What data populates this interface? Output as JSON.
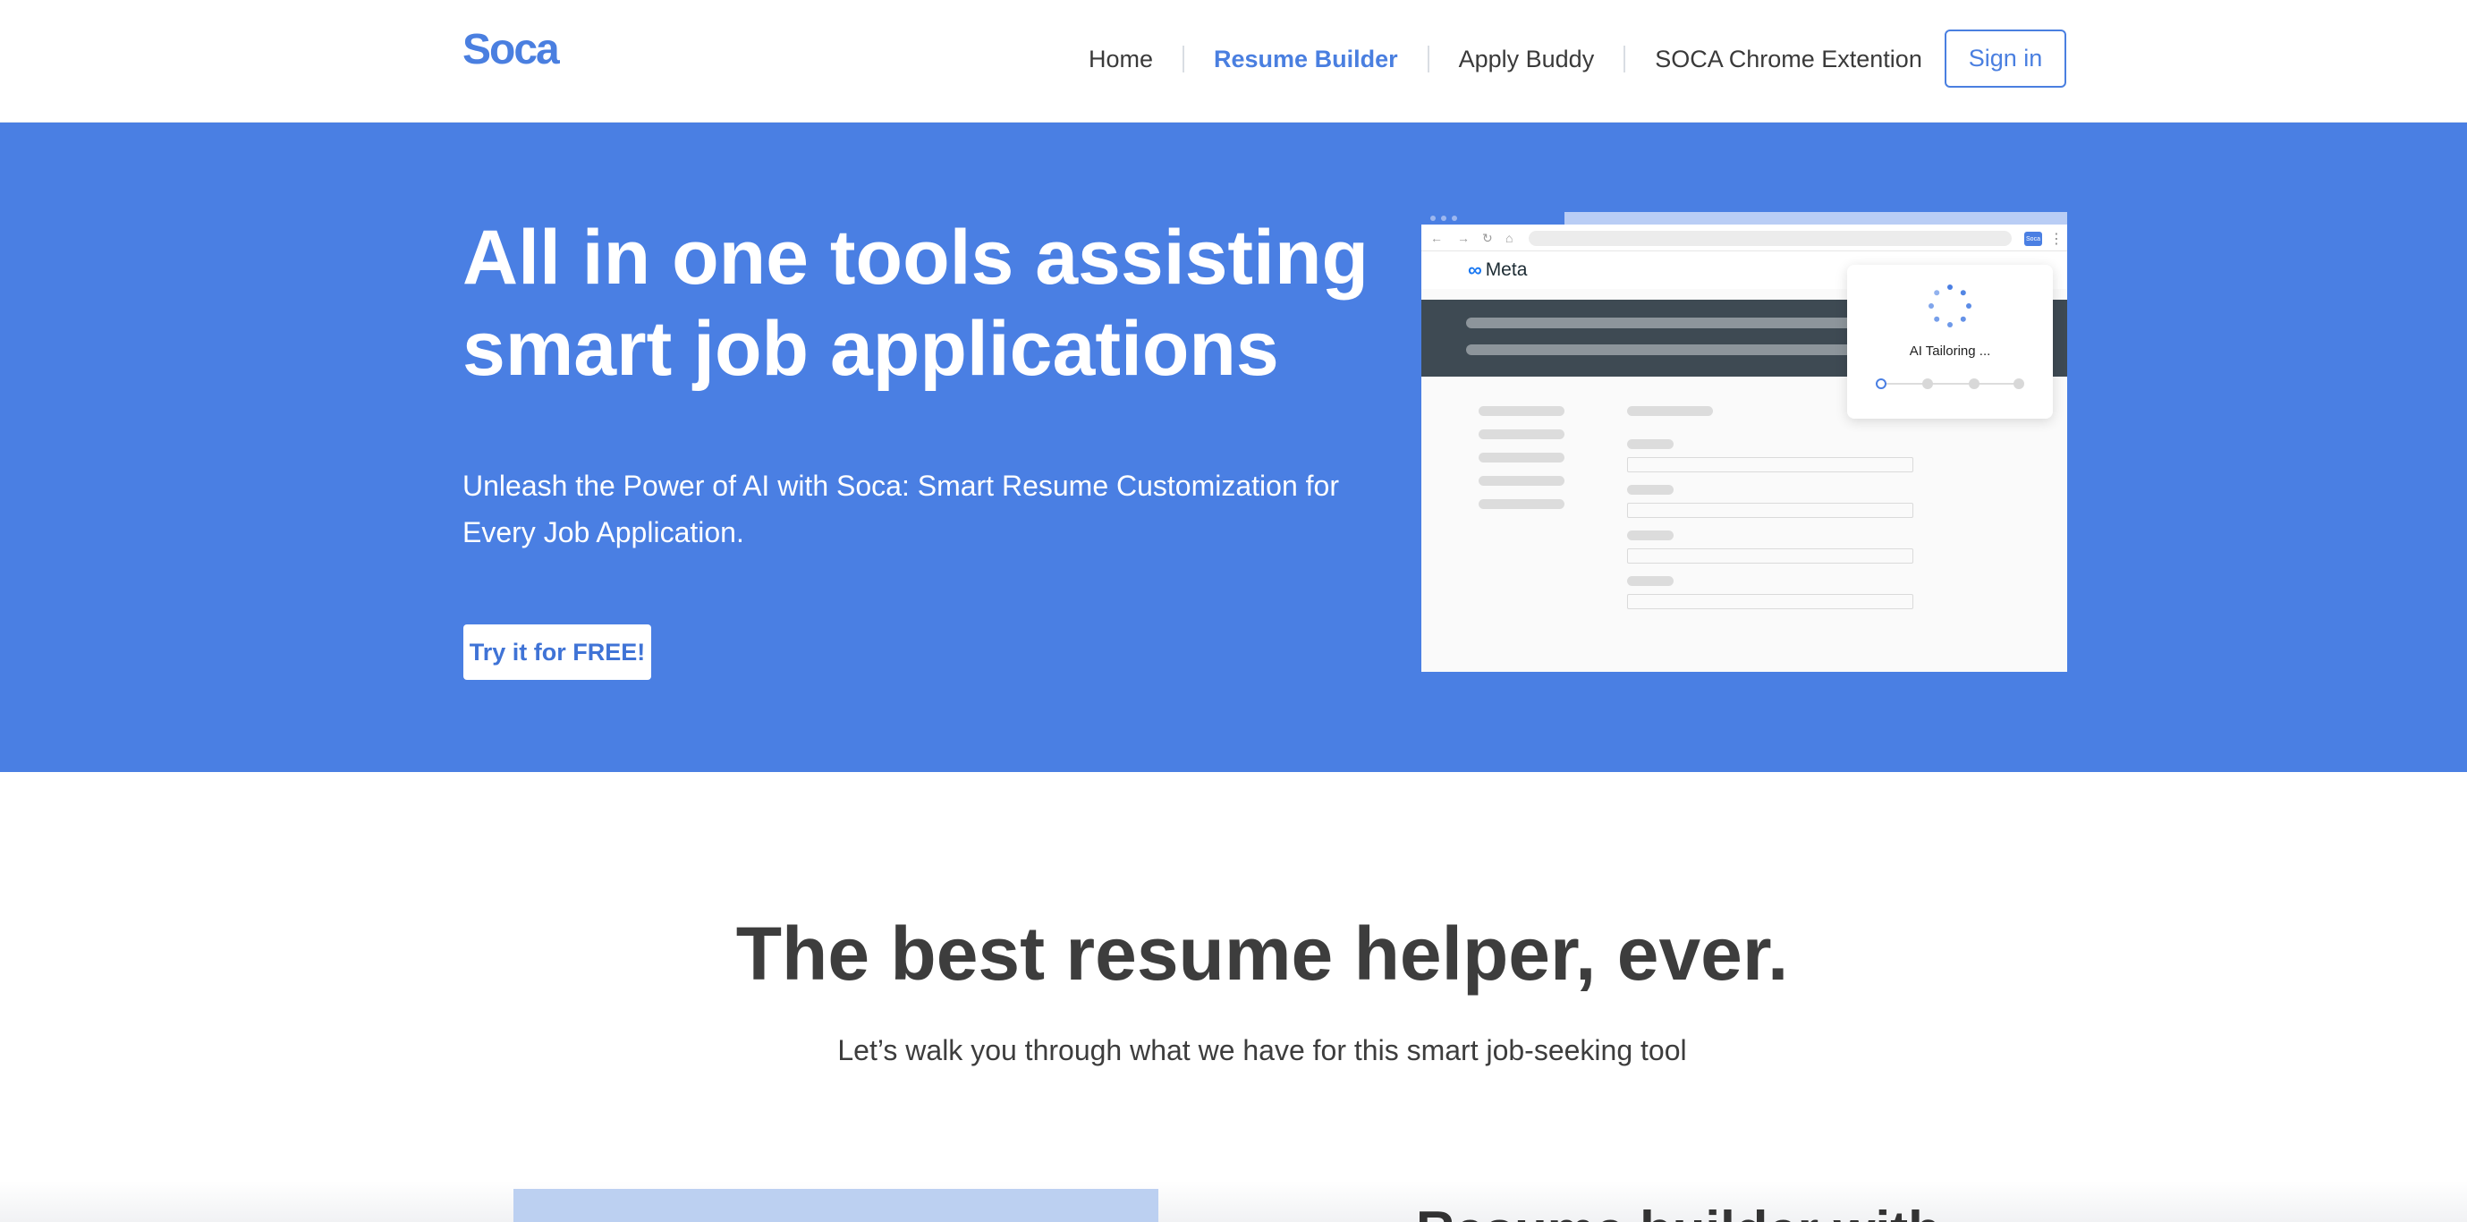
{
  "brand": {
    "logo": "Soca",
    "accent": "#4a7fe0",
    "hero_bg": "#4a7fe3"
  },
  "nav": {
    "items": [
      {
        "label": "Home",
        "active": false
      },
      {
        "label": "Resume Builder",
        "active": true
      },
      {
        "label": "Apply Buddy",
        "active": false
      },
      {
        "label": "SOCA Chrome Extention",
        "active": false
      }
    ],
    "signin_label": "Sign in"
  },
  "hero": {
    "title": "All in one tools assisting smart job applications",
    "subtitle": "Unleash the Power of AI with Soca: Smart Resume Customization for Every Job Application.",
    "cta_label": "Try it for FREE!",
    "mockup": {
      "company": "Meta",
      "extension_badge": "Soca",
      "status_text": "AI Tailoring ...",
      "steps": 4
    }
  },
  "section": {
    "title": "The best resume helper, ever.",
    "subtitle": "Let’s walk you through what we have for this smart job-seeking tool",
    "next_heading": "Resume builder with"
  }
}
